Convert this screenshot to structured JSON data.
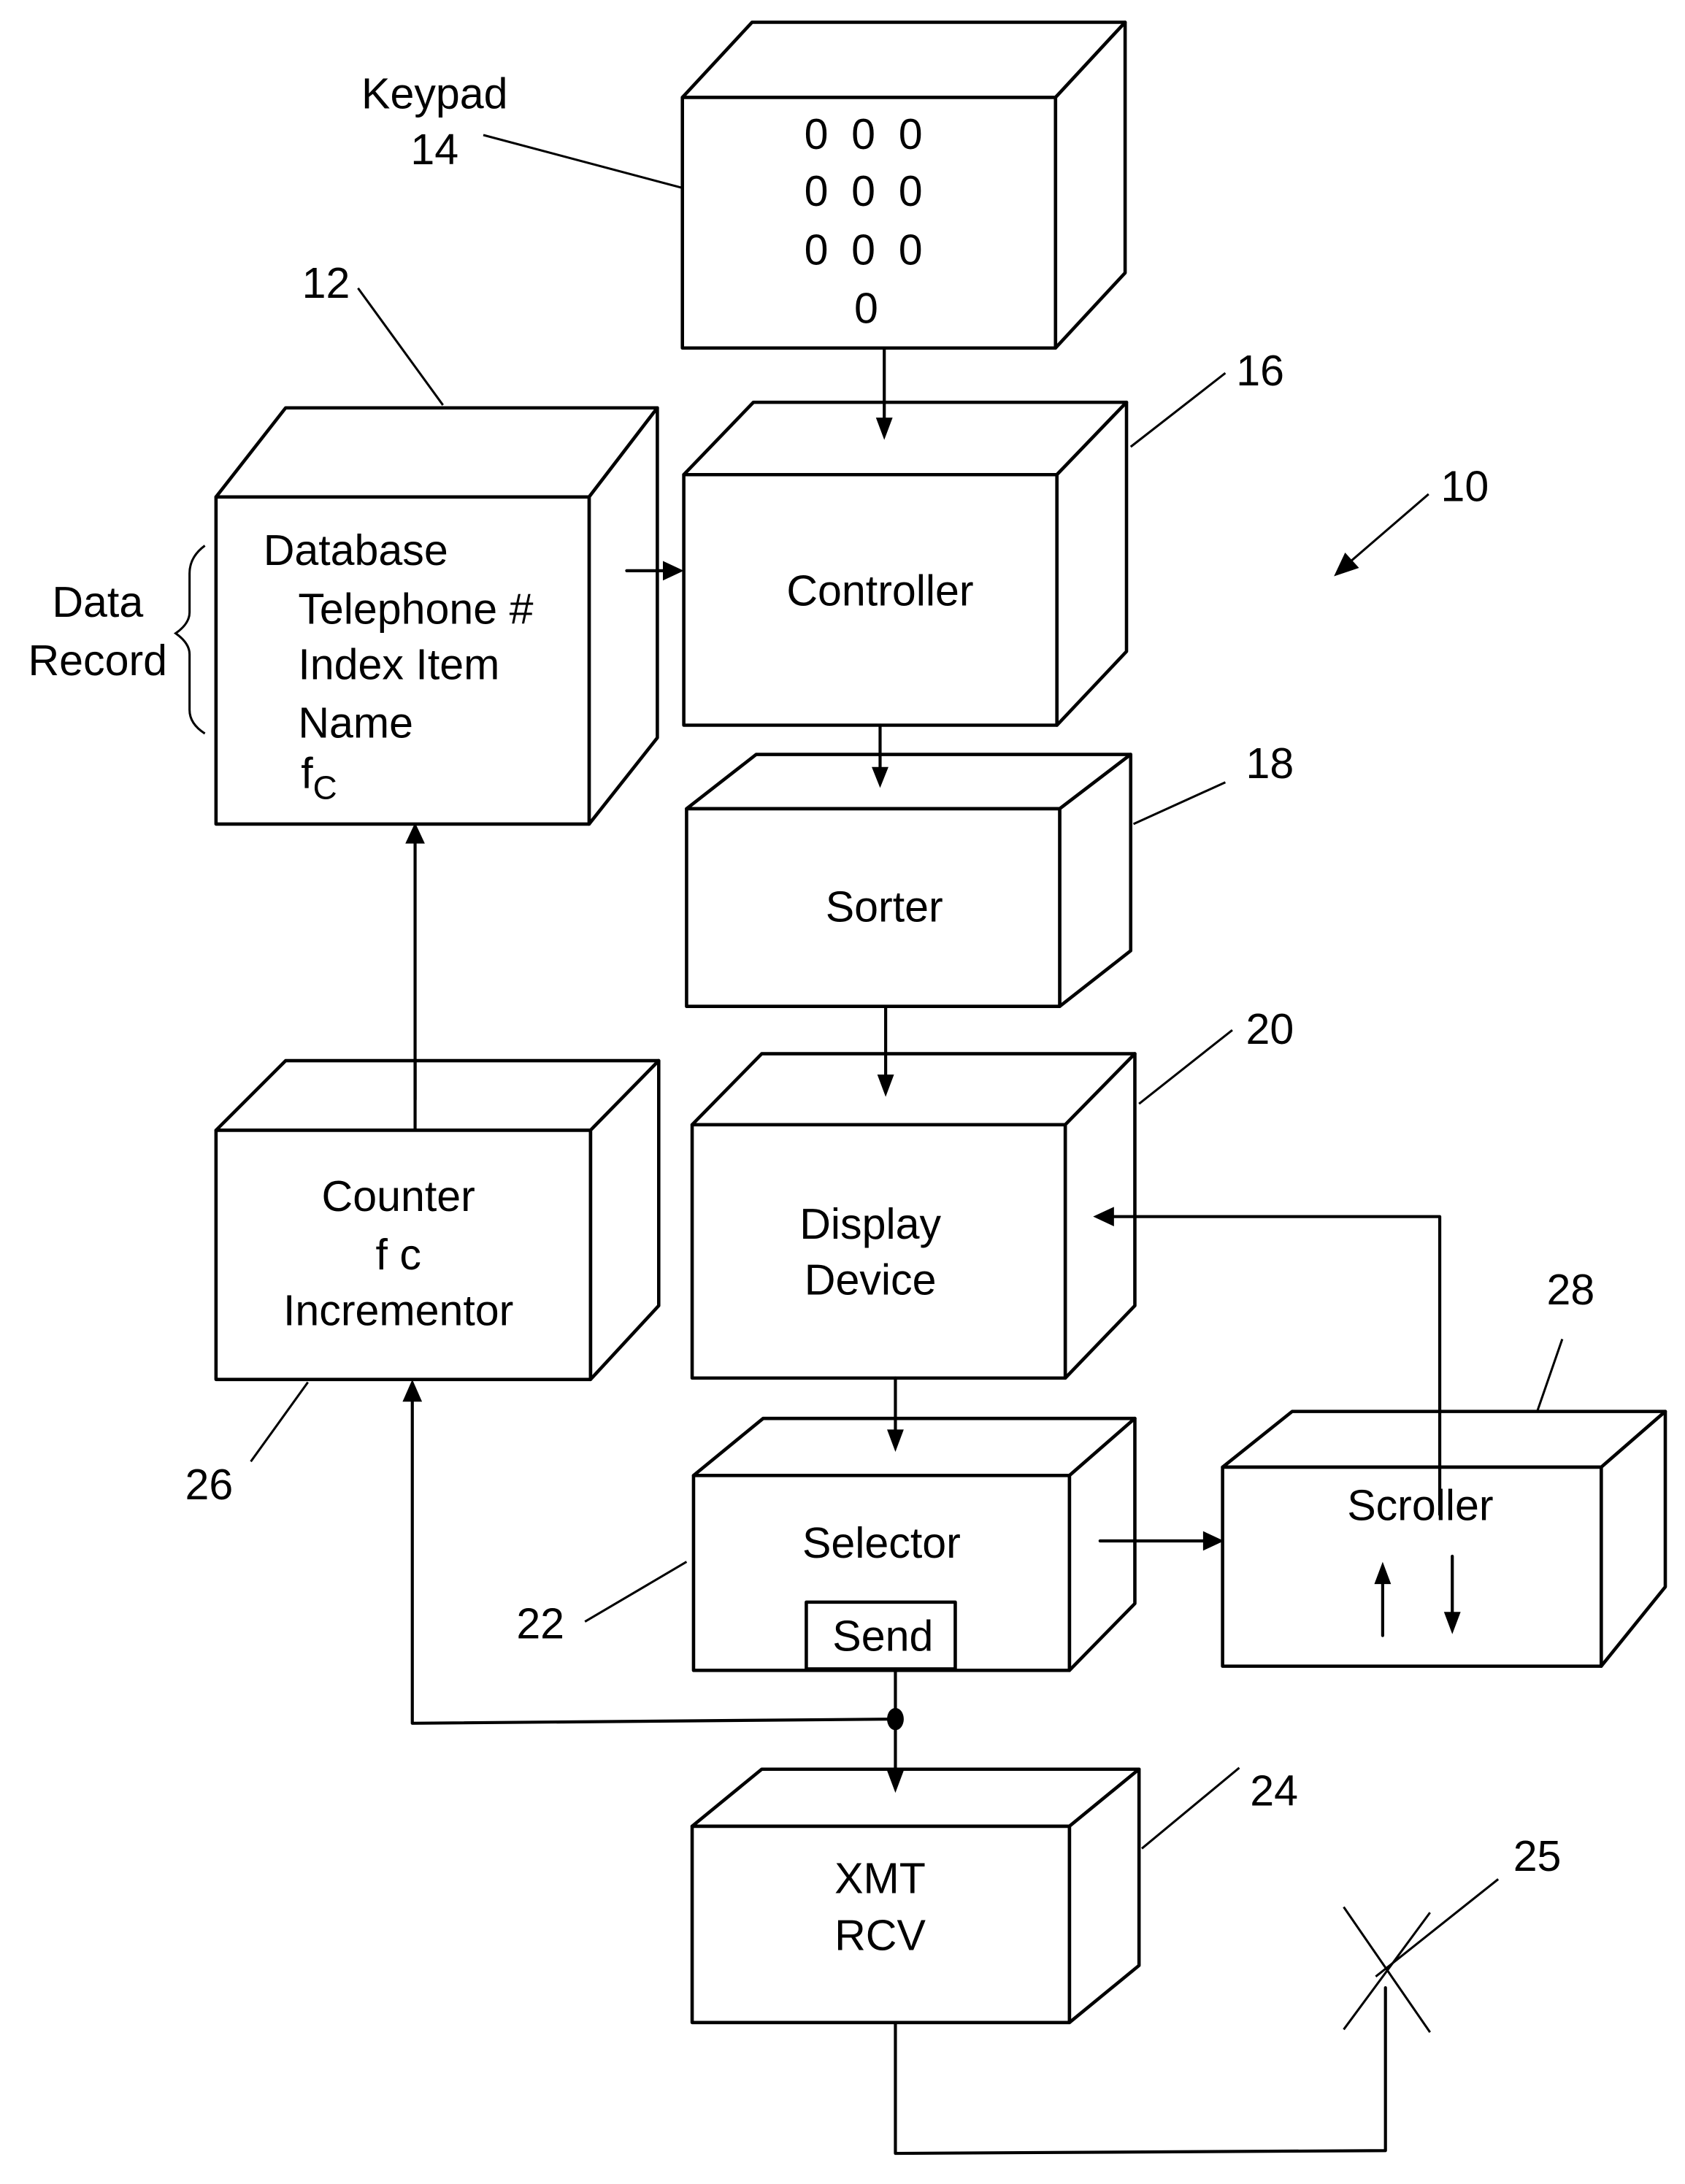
{
  "figure": {
    "system_ref": "10",
    "blocks": {
      "keypad": {
        "ref": "14",
        "label": "Keypad",
        "keys": [
          "0 0 0",
          "0 0 0",
          "0 0 0",
          "0"
        ]
      },
      "database": {
        "ref": "12",
        "title": "Database",
        "fields": [
          "Telephone #",
          "Index Item",
          "Name"
        ],
        "fc_main": "f",
        "fc_sub": "C"
      },
      "data_record": {
        "line1": "Data",
        "line2": "Record"
      },
      "controller": {
        "ref": "16",
        "label": "Controller"
      },
      "sorter": {
        "ref": "18",
        "label": "Sorter"
      },
      "display": {
        "ref": "20",
        "line1": "Display",
        "line2": "Device"
      },
      "counter": {
        "ref": "26",
        "line1": "Counter",
        "line2": "f c",
        "line3": "Incrementor"
      },
      "selector": {
        "ref": "22",
        "label": "Selector",
        "send": "Send"
      },
      "scroller": {
        "ref": "28",
        "label": "Scroller",
        "up_icon": "up-arrow",
        "down_icon": "down-arrow"
      },
      "transceiver": {
        "ref": "24",
        "line1": "XMT",
        "line2": "RCV"
      },
      "antenna": {
        "ref": "25"
      }
    }
  }
}
